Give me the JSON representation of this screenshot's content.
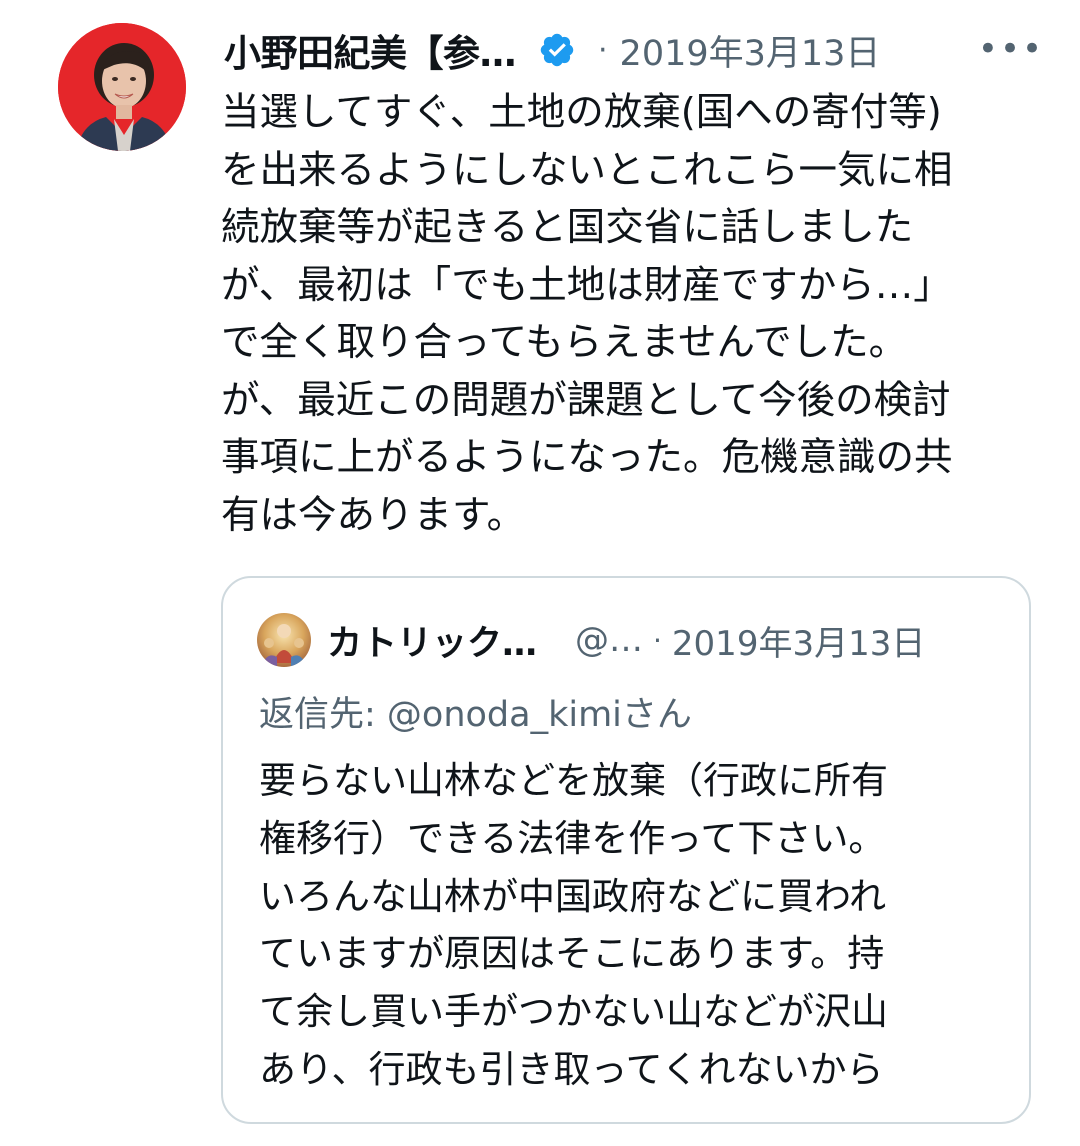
{
  "tweet": {
    "display_name": "小野田紀美【参…",
    "separator": "·",
    "date": "2019年3月13日",
    "more_label": "•••",
    "verified_icon": "verified-badge-icon",
    "avatar_icon": "profile-photo",
    "text": "当選してすぐ、土地の放棄(国への寄付等)\nを出来るようにしないとこれこら一気に相\n続放棄等が起きると国交省に話しました\nが、最初は「でも土地は財産ですから…」\nで全く取り合ってもらえませんでした。\nが、最近この問題が課題として今後の検討\n事項に上がるようになった。危機意識の共\n有は今あります。"
  },
  "quoted_tweet": {
    "display_name": "カトリック…",
    "handle": "@…",
    "separator": "·",
    "date": "2019年3月13日",
    "reply_prefix": "返信先: ",
    "reply_mention": "@onoda_kimi",
    "reply_suffix": "さん",
    "text": "要らない山林などを放棄（行政に所有\n権移行）できる法律を作って下さい。\nいろんな山林が中国政府などに買われ\nていますが原因はそこにあります。持\nて余し買い手がつかない山などが沢山\nあり、行政も引き取ってくれないから"
  },
  "colors": {
    "text": "#0f1419",
    "secondary": "#536471",
    "verified": "#1d9bf0",
    "border": "#cfd9de",
    "avatar_bg": "#e5262a"
  }
}
